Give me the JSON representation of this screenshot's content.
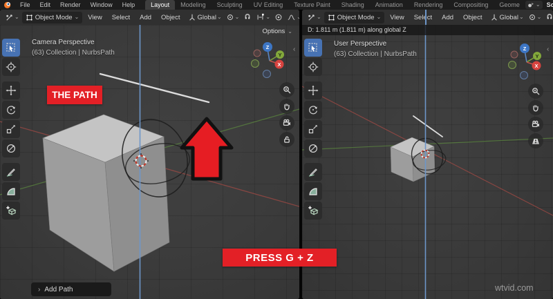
{
  "topbar": {
    "menus": [
      "File",
      "Edit",
      "Render",
      "Window",
      "Help"
    ],
    "tabs": [
      {
        "label": "Layout",
        "active": true
      },
      {
        "label": "Modeling",
        "active": false
      },
      {
        "label": "Sculpting",
        "active": false
      },
      {
        "label": "UV Editing",
        "active": false
      },
      {
        "label": "Texture Paint",
        "active": false
      },
      {
        "label": "Shading",
        "active": false
      },
      {
        "label": "Animation",
        "active": false
      },
      {
        "label": "Rendering",
        "active": false
      },
      {
        "label": "Compositing",
        "active": false
      },
      {
        "label": "Geome",
        "active": false
      }
    ],
    "scene_label": "Scene"
  },
  "header": {
    "mode_label": "Object Mode",
    "menus": [
      "View",
      "Select",
      "Add",
      "Object"
    ],
    "orientation_label": "Global",
    "options_label": "Options"
  },
  "left": {
    "view_name": "Camera Perspective",
    "collection_info": "(63) Collection | NurbsPath",
    "callout": "THE PATH",
    "add_path_label": "Add Path"
  },
  "right": {
    "transform_status": "D: 1.811 m (1.811 m) along global Z",
    "view_name": "User Perspective",
    "collection_info": "(63) Collection | NurbsPath"
  },
  "overlay": {
    "press_label": "PRESS G + Z",
    "watermark": "wtvid.com"
  },
  "gizmo": {
    "x_label": "X",
    "y_label": "Y",
    "z_label": "Z"
  },
  "icons": {
    "chevron_down": "⌄",
    "panel_expand": "›",
    "sidebar_collapse": "‹"
  },
  "colors": {
    "accent_red": "#e32026",
    "select_blue": "#4772b3",
    "axis_x": "#d8433f",
    "axis_y": "#83a83b",
    "axis_z": "#3d76c5"
  }
}
